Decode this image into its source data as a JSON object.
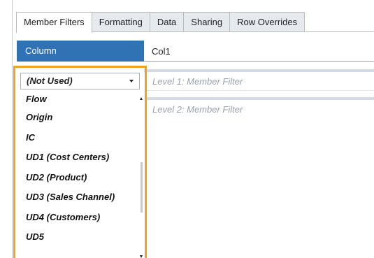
{
  "tabs": [
    {
      "label": "Member Filters",
      "active": true
    },
    {
      "label": "Formatting",
      "active": false
    },
    {
      "label": "Data",
      "active": false
    },
    {
      "label": "Sharing",
      "active": false
    },
    {
      "label": "Row Overrides",
      "active": false
    }
  ],
  "column": {
    "label": "Column",
    "value": "Col1"
  },
  "levels": [
    {
      "placeholder": "Level 1: Member Filter"
    },
    {
      "placeholder": "Level 2: Member Filter"
    }
  ],
  "combo": {
    "selected": "(Not Used)"
  },
  "dropdown": {
    "items": [
      "Flow",
      "Origin",
      "IC",
      "UD1 (Cost Centers)",
      "UD2 (Product)",
      "UD3 (Sales Channel)",
      "UD4 (Customers)",
      "UD5"
    ]
  },
  "colors": {
    "accent_blue": "#2f73b5",
    "highlight_orange": "#f2a21c"
  },
  "icons": {
    "combo_arrow": "chevron-down-icon",
    "scroll_up": "scroll-up-icon",
    "scroll_down": "scroll-down-icon"
  }
}
